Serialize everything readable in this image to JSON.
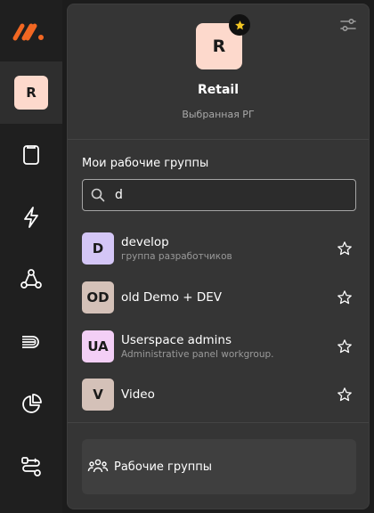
{
  "rail": {
    "logo_icon": "brand-logo-icon",
    "active_avatar": "R",
    "icons": [
      "clipboard-icon",
      "lightning-icon",
      "graph-nodes-icon",
      "stream-icon",
      "pie-chart-icon",
      "workflow-icon"
    ]
  },
  "org": {
    "avatar": "R",
    "name": "Retail",
    "subtitle": "Выбранная РГ"
  },
  "groups_section": {
    "title": "Мои рабочие группы",
    "search_value": "d",
    "items": [
      {
        "avatar": "D",
        "name": "develop",
        "description": "группа разработчиков",
        "avatar_color": "#d4c6f6"
      },
      {
        "avatar": "OD",
        "name": "old Demo + DEV",
        "description": "",
        "avatar_color": "#d4c1b8"
      },
      {
        "avatar": "UA",
        "name": "Userspace admins",
        "description": "Administrative panel workgroup.",
        "avatar_color": "#f3cff6"
      },
      {
        "avatar": "V",
        "name": "Video",
        "description": "",
        "avatar_color": "#d4c1b8"
      }
    ]
  },
  "footer": {
    "label": "Рабочие группы"
  },
  "colors": {
    "accent_orange": "#f26722",
    "star_yellow": "#f3c623"
  }
}
